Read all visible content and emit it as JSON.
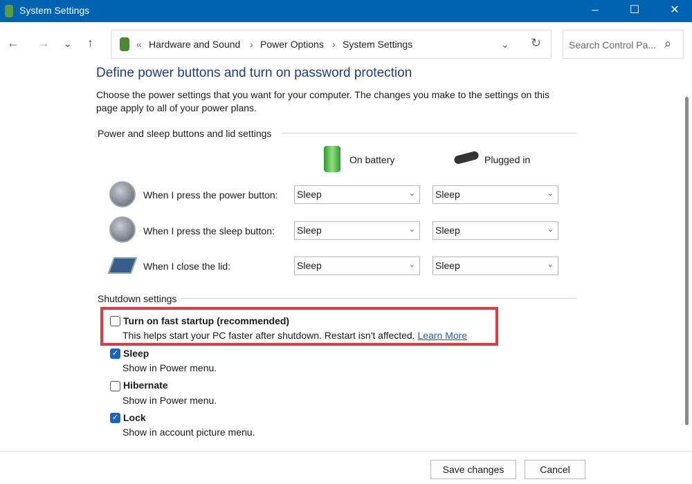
{
  "window": {
    "title": "System Settings",
    "minimize": "–",
    "maximize": "☐",
    "close": "✕"
  },
  "nav": {
    "back": "←",
    "forward": "→",
    "recent": "⌄",
    "up": "↑"
  },
  "address": {
    "prefix": "«",
    "crumbs": [
      "Hardware and Sound",
      "Power Options",
      "System Settings"
    ],
    "sep": "›",
    "dropdown": "⌄",
    "refresh": "↻"
  },
  "search": {
    "placeholder": "Search Control Pa...",
    "icon": "⌕"
  },
  "page": {
    "title": "Define power buttons and turn on password protection",
    "description": "Choose the power settings that you want for your computer. The changes you make to the settings on this page apply to all of your power plans."
  },
  "buttons_section": {
    "heading": "Power and sleep buttons and lid settings",
    "col_battery": "On battery",
    "col_plugged": "Plugged in",
    "rows": [
      {
        "label": "When I press the power button:",
        "battery": "Sleep",
        "plugged": "Sleep"
      },
      {
        "label": "When I press the sleep button:",
        "battery": "Sleep",
        "plugged": "Sleep"
      },
      {
        "label": "When I close the lid:",
        "battery": "Sleep",
        "plugged": "Sleep"
      }
    ]
  },
  "shutdown": {
    "heading": "Shutdown settings",
    "items": [
      {
        "label": "Turn on fast startup (recommended)",
        "desc": "This helps start your PC faster after shutdown. Restart isn't affected.",
        "link": "Learn More",
        "checked": false
      },
      {
        "label": "Sleep",
        "desc": "Show in Power menu.",
        "checked": true
      },
      {
        "label": "Hibernate",
        "desc": "Show in Power menu.",
        "checked": false
      },
      {
        "label": "Lock",
        "desc": "Show in account picture menu.",
        "checked": true
      }
    ],
    "highlight_color": "#e0393e"
  },
  "footer": {
    "save": "Save changes",
    "cancel": "Cancel"
  },
  "colors": {
    "titlebar": "#0063b1",
    "heading": "#1e3b8a",
    "checkbox": "#1a62c6"
  }
}
